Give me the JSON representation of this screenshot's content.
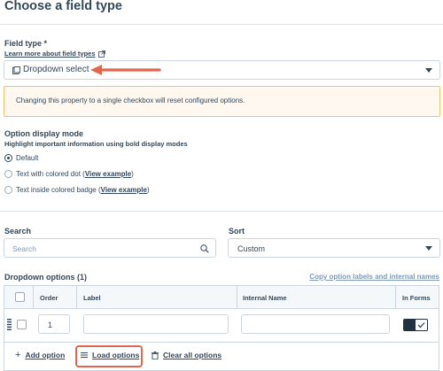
{
  "page": {
    "title": "Choose a field type"
  },
  "field_type": {
    "label": "Field type *",
    "help_link": "Learn more about field types",
    "selected": "Dropdown select"
  },
  "alert": {
    "text": "Changing this property to a single checkbox will reset configured options."
  },
  "display_mode": {
    "heading": "Option display mode",
    "subheading": "Highlight important information using bold display modes",
    "options": [
      {
        "label": "Default",
        "link": "",
        "suffix": "",
        "selected": true
      },
      {
        "label": "Text with colored dot (",
        "link": "View example",
        "suffix": ")",
        "selected": false
      },
      {
        "label": "Text inside colored badge (",
        "link": "View example",
        "suffix": ")",
        "selected": false
      }
    ]
  },
  "search": {
    "label": "Search",
    "placeholder": "Search"
  },
  "sort": {
    "label": "Sort",
    "selected": "Custom"
  },
  "options_table": {
    "title": "Dropdown options (1)",
    "copy_link": "Copy option labels and internal names",
    "columns": {
      "order": "Order",
      "label": "Label",
      "internal_name": "Internal Name",
      "in_forms": "In Forms"
    },
    "rows": [
      {
        "order": "1",
        "label": "",
        "internal_name": "",
        "in_forms": true
      }
    ]
  },
  "footer": {
    "add_option": "Add option",
    "load_options": "Load options",
    "clear_all": "Clear all options"
  },
  "colors": {
    "annotation": "#e0664f",
    "text": "#33475b",
    "border": "#cbd6e2",
    "alert_bg": "#fef8f0",
    "alert_border": "#f5c26b"
  }
}
